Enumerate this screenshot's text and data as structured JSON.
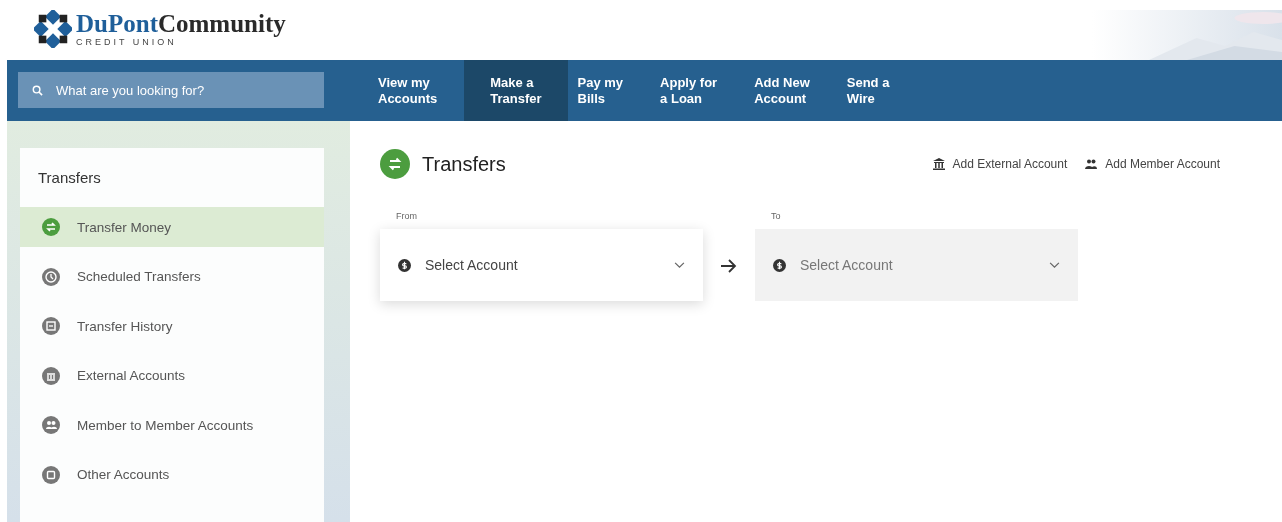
{
  "logo": {
    "name_first": "DuPont",
    "name_second": "Community",
    "tagline": "CREDIT UNION"
  },
  "search": {
    "placeholder": "What are you looking for?"
  },
  "nav": [
    {
      "label": "View my\nAccounts",
      "selected": false
    },
    {
      "label": "Make a\nTransfer",
      "selected": true
    },
    {
      "label": "Pay my\nBills",
      "selected": false
    },
    {
      "label": "Apply for\na Loan",
      "selected": false
    },
    {
      "label": "Add New\nAccount",
      "selected": false
    },
    {
      "label": "Send a\nWire",
      "selected": false
    }
  ],
  "sidebar": {
    "title": "Transfers",
    "items": [
      {
        "label": "Transfer Money",
        "selected": true
      },
      {
        "label": "Scheduled Transfers",
        "selected": false
      },
      {
        "label": "Transfer History",
        "selected": false
      },
      {
        "label": "External Accounts",
        "selected": false
      },
      {
        "label": "Member to Member Accounts",
        "selected": false
      },
      {
        "label": "Other Accounts",
        "selected": false
      }
    ]
  },
  "main": {
    "title": "Transfers",
    "links": [
      "Add External Account",
      "Add Member Account"
    ],
    "from": {
      "label": "From",
      "placeholder": "Select Account",
      "disabled": false
    },
    "to": {
      "label": "To",
      "placeholder": "Select Account",
      "disabled": true
    }
  }
}
